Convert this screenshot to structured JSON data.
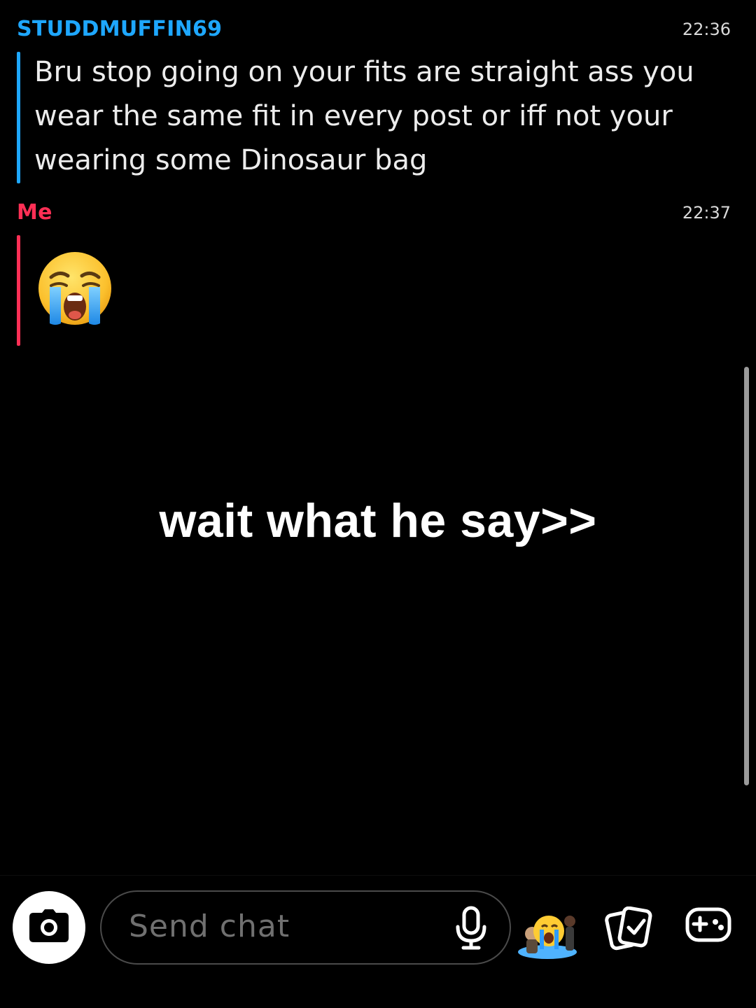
{
  "messages": [
    {
      "sender": "STUDDMUFFIN69",
      "time": "22:36",
      "text": "Bru stop going on your fits are straight ass you wear the same fit in every post or iff not your wearing some Dinosaur bag",
      "accent_color": "#1ea7ff"
    },
    {
      "sender": "Me",
      "time": "22:37",
      "content_icon": "loudly-crying-face-emoji",
      "accent_color": "#ff2f55"
    }
  ],
  "overlay_caption": "wait what he say>>",
  "composer": {
    "placeholder": "Send chat",
    "camera_icon": "camera-icon",
    "mic_icon": "microphone-icon",
    "bitmoji_icon": "crying-bitmoji-sticker",
    "memories_icon": "memories-cards-icon",
    "games_icon": "gamepad-icon"
  }
}
